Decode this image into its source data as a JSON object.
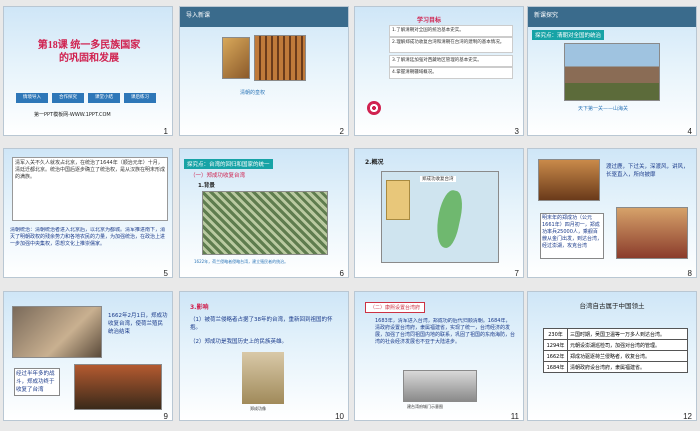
{
  "slides": [
    {
      "num": "1",
      "title_line1": "第18课  统一多民族国家",
      "title_line2": "的巩固和发展",
      "nav": [
        "情境导入",
        "合作探究",
        "课堂小结",
        "课后练习"
      ],
      "footer": "第一PPT模板网-WWW.1PPT.COM"
    },
    {
      "num": "2",
      "bar": "导入新课",
      "caption": "清朝的皇权"
    },
    {
      "num": "3",
      "heading": "学习目标",
      "goals": [
        "1.了解清朝对全国的统治基本史实。",
        "2.理解郑成功收复台湾和清朝在台湾的建制的基本情况。",
        "3.了解清廷加强对西藏地区管理的基本史实。",
        "4.掌握清朝疆域概况。"
      ]
    },
    {
      "num": "4",
      "bar": "新课探究",
      "tag": "探究点：清朝对全国的统治",
      "caption": "天下第一关——山海关"
    },
    {
      "num": "5",
      "para": "清军入关不久人就攻占北京，在统治了1644年（顺治元年）十月，清廷迁都北京。统治中国后逐步确立了统治权，是从汉族在明末形成的满族。",
      "note": "清朝统治：清朝统治者进入北京后，以北京为都城。清军推进南下，消灭了明朝政权的残余势力和各地农民的力量，为加强统治，在政治上进一步加强中央集权，思想文化上推崇儒家。"
    },
    {
      "num": "6",
      "tag": "探究点：台湾的回归和国家的统一",
      "sub": "（一）郑成功收复台湾",
      "sub2": "1.背景",
      "caption": "1622年，荷兰侵略者侵略台湾，建立殖民者的统治。"
    },
    {
      "num": "7",
      "heading": "2.概况",
      "map_label": "郑成功收复台湾"
    },
    {
      "num": "8",
      "text1": "渡过鹿，下过关，深渡风，讲风，长驱直入，所向披靡",
      "text2": "明末年的郑成功（公元1661年）四月初一，郑成功率兵25000人，乘舰百艘从金门出发，到达台湾，经过澎湖，攻克台湾"
    },
    {
      "num": "9",
      "text1": "1662年2月1日，郑成功收复台湾，使荷兰殖民统治结束",
      "text2": "经过半年多的战斗，郑成功终于收复了台湾"
    },
    {
      "num": "10",
      "heading": "3.影响",
      "p1": "（1）被荷兰侵略者占据了38年的台湾，重新回到祖国的怀抱。",
      "p2": "（2）郑成功是我国历史上的民族英雄。",
      "caption": "郑成功像"
    },
    {
      "num": "11",
      "tag": "（二）康熙设置台湾府",
      "para": "1683年，清军进入台湾，郑成功的后代归顺清朝。1684年，清政府设置台湾府，隶属福建省，实现了统一，台湾经济的发展，加强了台湾同祖国内地的联系，巩固了祖国的东南海防，台湾的社会经济发展也不亚于大陆进步。",
      "caption": "建台湾府城门示意图"
    },
    {
      "num": "12",
      "title": "台湾自古属于中国领土",
      "rows": [
        [
          "230年",
          "三国时期，吴国卫温等一万多人到达台湾。"
        ],
        [
          "1294年",
          "元朝设澎湖巡检司，加强对台湾的管理。"
        ],
        [
          "1662年",
          "郑成功驱逐荷兰侵略者，收复台湾。"
        ],
        [
          "1684年",
          "清朝政府设台湾府，隶属福建省。"
        ]
      ]
    }
  ]
}
